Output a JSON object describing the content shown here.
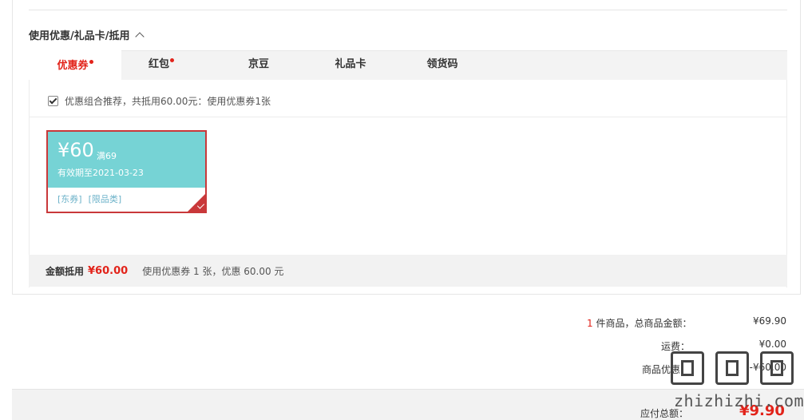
{
  "section": {
    "title": "使用优惠/礼品卡/抵用"
  },
  "tabs": [
    {
      "label": "优惠券",
      "dot": true,
      "active": true
    },
    {
      "label": "红包",
      "dot": true,
      "active": false
    },
    {
      "label": "京豆",
      "dot": false,
      "active": false
    },
    {
      "label": "礼品卡",
      "dot": false,
      "active": false
    },
    {
      "label": "领货码",
      "dot": false,
      "active": false
    }
  ],
  "recommend": {
    "text": "优惠组合推荐，共抵用60.00元：使用优惠券1张",
    "checked": true
  },
  "coupon": {
    "amount": "¥60",
    "condition": "满69",
    "valid": "有效期至2021-03-23",
    "tag1": "[东券]",
    "tag2": "[限品类]",
    "selected": true,
    "color_top": "#76d3d5",
    "color_border": "#c9383a"
  },
  "summary": {
    "label": "金额抵用",
    "amount": "¥60.00",
    "desc": "使用优惠券 1 张，优惠 60.00 元"
  },
  "totals": {
    "count": "1",
    "items_label": " 件商品，总商品金额：",
    "items_value": "¥69.90",
    "shipping_label": "运费：",
    "shipping_value": "¥0.00",
    "discount_label": "商品优惠：",
    "discount_value": "-¥60.00",
    "pay_label": "应付总额：",
    "pay_value": "¥9.90"
  },
  "watermark": {
    "text": "zhizhizhi.com"
  },
  "colors": {
    "accent_red": "#e2231a",
    "tab_bg": "#f3f3f3"
  }
}
